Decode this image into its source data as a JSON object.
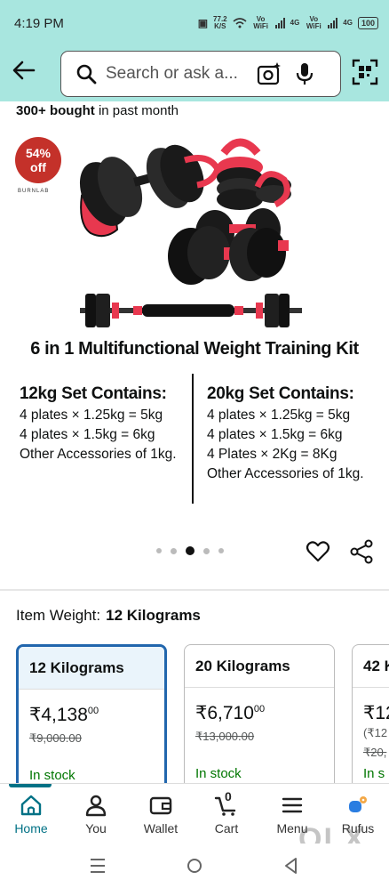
{
  "status_bar": {
    "time": "4:19 PM",
    "speed": "77.2",
    "speed_unit": "K/S",
    "net1": "Vo WiFi",
    "net1_gen": "4G",
    "net2": "Vo WiFi",
    "net2_gen": "4G",
    "battery": "100"
  },
  "header": {
    "search_placeholder": "Search or ask a..."
  },
  "social_proof": {
    "count": "300+ bought",
    "suffix": "in past month"
  },
  "product_image": {
    "discount_value": "54%",
    "discount_label": "off",
    "brand": "BURNLAB",
    "title": "6 in 1 Multifunctional Weight Training Kit",
    "sets": [
      {
        "heading": "12kg Set Contains:",
        "lines": [
          "4 plates × 1.25kg = 5kg",
          "4 plates × 1.5kg = 6kg",
          "Other Accessories of 1kg."
        ]
      },
      {
        "heading": "20kg Set Contains:",
        "lines": [
          "4 plates × 1.25kg = 5kg",
          "4 plates × 1.5kg = 6kg",
          "4 Plates × 2Kg = 8Kg",
          "Other Accessories of 1kg."
        ]
      }
    ],
    "carousel": {
      "count": 5,
      "active_index": 2
    }
  },
  "item_weight": {
    "label": "Item Weight:",
    "value": "12 Kilograms"
  },
  "variants": [
    {
      "name": "12 Kilograms",
      "price": "₹4,138",
      "price_paise": "00",
      "mrp": "₹9,000.00",
      "stock": "In stock",
      "selected": true
    },
    {
      "name": "20 Kilograms",
      "price": "₹6,710",
      "price_paise": "00",
      "mrp": "₹13,000.00",
      "stock": "In stock",
      "selected": false
    },
    {
      "name": "42 K",
      "price": "₹12",
      "price_paise": "",
      "extra": "(₹12",
      "mrp": "₹20,",
      "stock": "In s",
      "selected": false
    }
  ],
  "bottom_nav": {
    "items": [
      {
        "label": "Home",
        "icon": "home-icon",
        "active": true
      },
      {
        "label": "You",
        "icon": "person-icon",
        "active": false
      },
      {
        "label": "Wallet",
        "icon": "wallet-icon",
        "active": false
      },
      {
        "label": "Cart",
        "icon": "cart-icon",
        "badge": "0",
        "active": false
      },
      {
        "label": "Menu",
        "icon": "menu-icon",
        "active": false
      },
      {
        "label": "Rufus",
        "icon": "rufus-icon",
        "active": false
      }
    ]
  },
  "watermark": "OLX",
  "colors": {
    "header_bg": "#a8e6df",
    "accent_teal": "#007185",
    "selected_border": "#2166ad",
    "discount_red": "#c4312a",
    "in_stock_green": "#007600"
  }
}
